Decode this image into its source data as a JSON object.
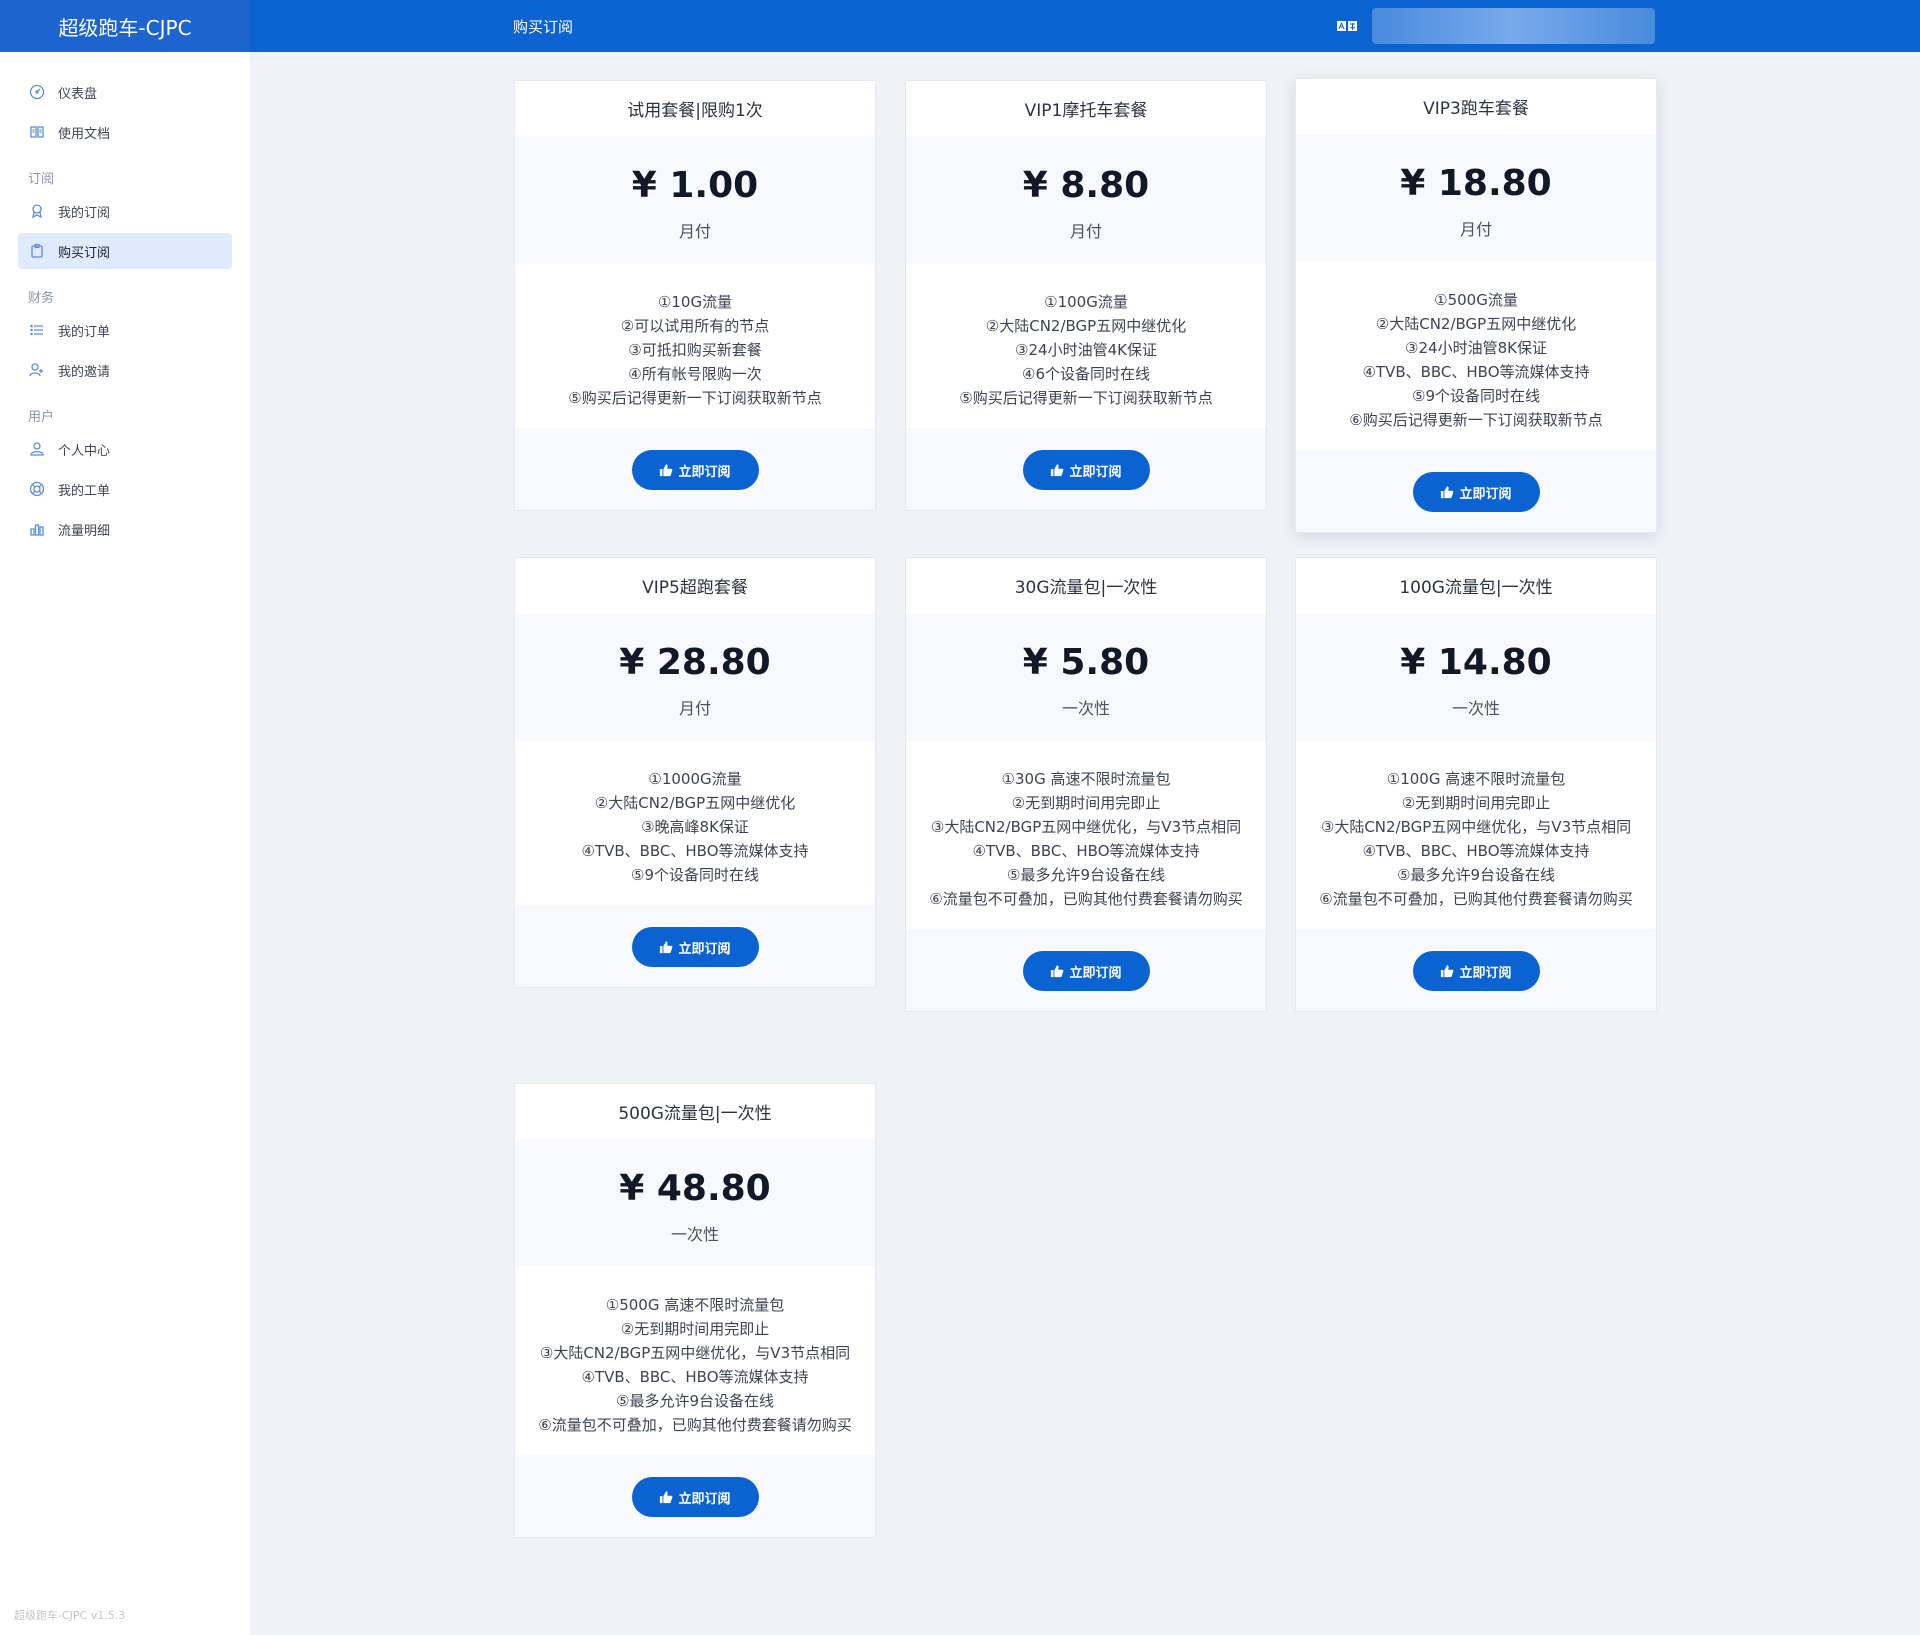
{
  "app": {
    "brand": "超级跑车-CJPC",
    "version": "超级跑车-CJPC v1.5.3"
  },
  "header": {
    "page_title": "购买订阅",
    "lang_icon": "translate-icon"
  },
  "sidebar": {
    "top_items": [
      {
        "label": "仪表盘",
        "icon": "dashboard-icon"
      },
      {
        "label": "使用文档",
        "icon": "book-icon"
      }
    ],
    "groups": [
      {
        "title": "订阅",
        "items": [
          {
            "label": "我的订阅",
            "icon": "subscription-icon"
          },
          {
            "label": "购买订阅",
            "icon": "clipboard-icon",
            "active": true
          }
        ]
      },
      {
        "title": "财务",
        "items": [
          {
            "label": "我的订单",
            "icon": "list-icon"
          },
          {
            "label": "我的邀请",
            "icon": "invite-icon"
          }
        ]
      },
      {
        "title": "用户",
        "items": [
          {
            "label": "个人中心",
            "icon": "user-icon"
          },
          {
            "label": "我的工单",
            "icon": "support-icon"
          },
          {
            "label": "流量明细",
            "icon": "bar-chart-icon"
          }
        ]
      }
    ]
  },
  "plans": [
    {
      "title": "试用套餐|限购1次",
      "price": "¥ 1.00",
      "period": "月付",
      "features": [
        "①10G流量",
        "②可以试用所有的节点",
        "③可抵扣购买新套餐",
        "④所有帐号限购一次",
        "⑤购买后记得更新一下订阅获取新节点"
      ],
      "button": "立即订阅"
    },
    {
      "title": "VIP1摩托车套餐",
      "price": "¥ 8.80",
      "period": "月付",
      "features": [
        "①100G流量",
        "②大陆CN2/BGP五网中继优化",
        "③24小时油管4K保证",
        "④6个设备同时在线",
        "⑤购买后记得更新一下订阅获取新节点"
      ],
      "button": "立即订阅"
    },
    {
      "title": "VIP3跑车套餐",
      "price": "¥ 18.80",
      "period": "月付",
      "features": [
        "①500G流量",
        "②大陆CN2/BGP五网中继优化",
        "③24小时油管8K保证",
        "④TVB、BBC、HBO等流媒体支持",
        "⑤9个设备同时在线",
        "⑥购买后记得更新一下订阅获取新节点"
      ],
      "button": "立即订阅"
    },
    {
      "title": "VIP5超跑套餐",
      "price": "¥ 28.80",
      "period": "月付",
      "features": [
        "①1000G流量",
        "②大陆CN2/BGP五网中继优化",
        "③晚高峰8K保证",
        "④TVB、BBC、HBO等流媒体支持",
        "⑤9个设备同时在线"
      ],
      "button": "立即订阅"
    },
    {
      "title": "30G流量包|一次性",
      "price": "¥ 5.80",
      "period": "一次性",
      "features": [
        "①30G 高速不限时流量包",
        "②无到期时间用完即止",
        "③大陆CN2/BGP五网中继优化，与V3节点相同",
        "④TVB、BBC、HBO等流媒体支持",
        "⑤最多允许9台设备在线",
        "⑥流量包不可叠加，已购其他付费套餐请勿购买"
      ],
      "button": "立即订阅"
    },
    {
      "title": "100G流量包|一次性",
      "price": "¥ 14.80",
      "period": "一次性",
      "features": [
        "①100G 高速不限时流量包",
        "②无到期时间用完即止",
        "③大陆CN2/BGP五网中继优化，与V3节点相同",
        "④TVB、BBC、HBO等流媒体支持",
        "⑤最多允许9台设备在线",
        "⑥流量包不可叠加，已购其他付费套餐请勿购买"
      ],
      "button": "立即订阅"
    },
    {
      "title": "500G流量包|一次性",
      "price": "¥ 48.80",
      "period": "一次性",
      "features": [
        "①500G 高速不限时流量包",
        "②无到期时间用完即止",
        "③大陆CN2/BGP五网中继优化，与V3节点相同",
        "④TVB、BBC、HBO等流媒体支持",
        "⑤最多允许9台设备在线",
        "⑥流量包不可叠加，已购其他付费套餐请勿购买"
      ],
      "button": "立即订阅"
    }
  ],
  "colors": {
    "primary": "#0b63d1",
    "active_bg": "#dfeafd",
    "page_bg": "#eff2f7"
  }
}
